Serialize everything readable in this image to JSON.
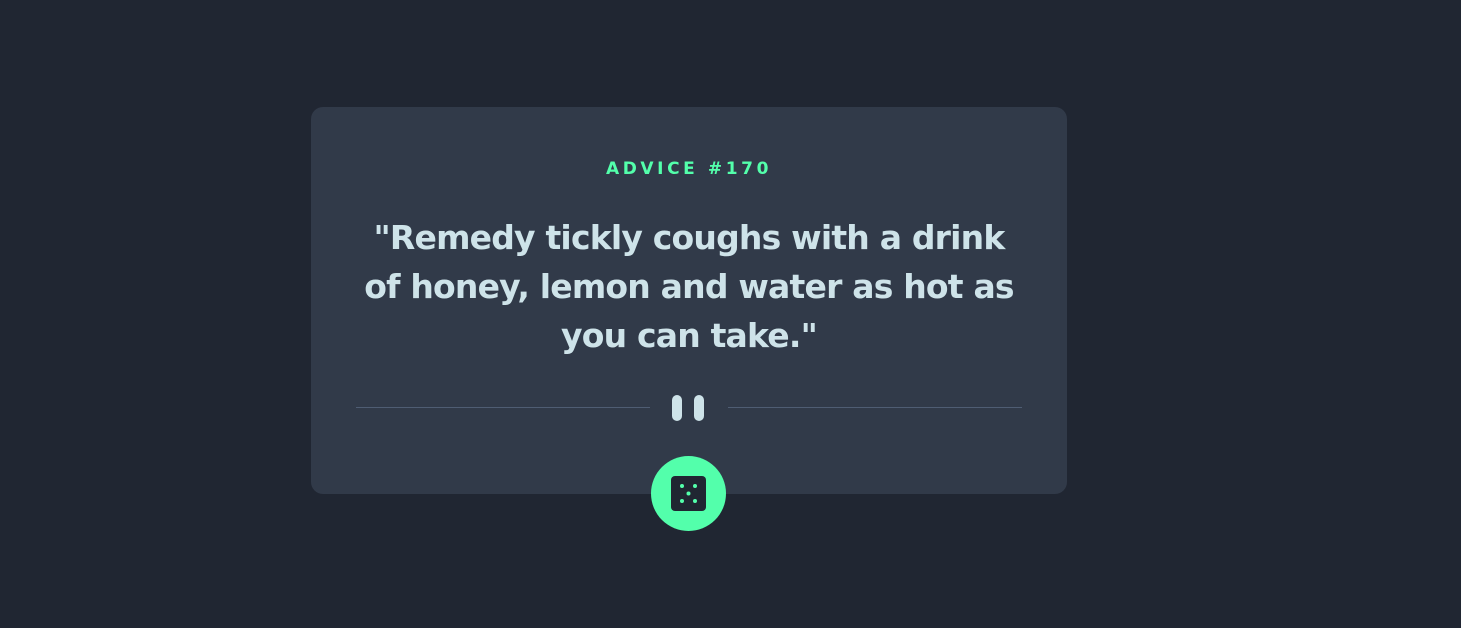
{
  "advice": {
    "id_label": "ADVICE #170",
    "quote": "\"Remedy tickly coughs with a drink of honey, lemon and water as hot as you can take.\""
  },
  "divider": {
    "icon": "pause-icon"
  },
  "actions": {
    "new_advice_icon": "dice-icon"
  },
  "colors": {
    "background": "#202632",
    "card": "#313a49",
    "accent": "#53ffab",
    "text": "#cee3e9",
    "divider": "#4f5d73"
  }
}
